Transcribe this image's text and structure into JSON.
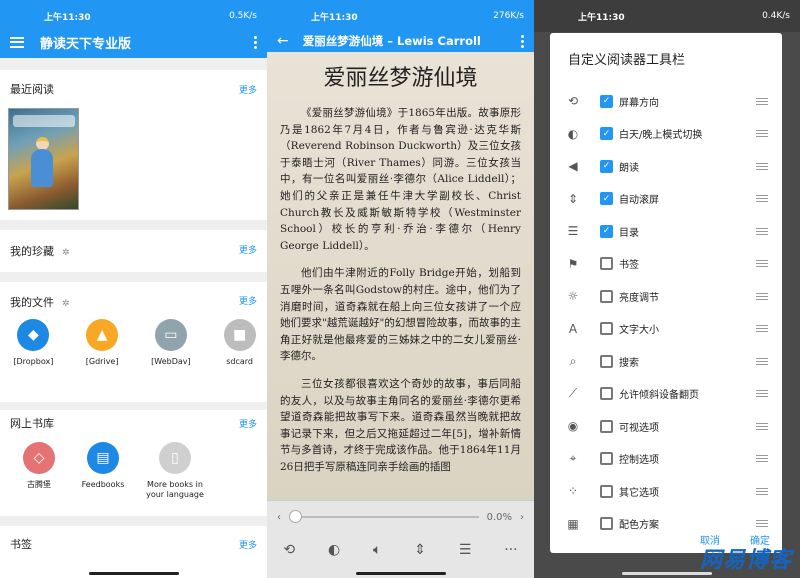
{
  "panel1": {
    "status": {
      "time": "上午11:30",
      "speed": "0.5K/s"
    },
    "appbar": {
      "title": "静读天下专业版"
    },
    "recent": {
      "label": "最近阅读",
      "more": "更多"
    },
    "fav": {
      "label": "我的珍藏",
      "more": "更多"
    },
    "files": {
      "label": "我的文件",
      "more": "更多",
      "items": [
        {
          "label": "[Dropbox]",
          "color": "#1e88e5",
          "icon": "dropbox-icon"
        },
        {
          "label": "[Gdrive]",
          "color": "#f9a825",
          "icon": "gdrive-icon"
        },
        {
          "label": "[WebDav]",
          "color": "#90a4ae",
          "icon": "webdav-icon"
        },
        {
          "label": "sdcard",
          "color": "#bdbdbd",
          "icon": "folder-icon"
        }
      ]
    },
    "online": {
      "label": "网上书库",
      "more": "更多",
      "items": [
        {
          "label": "古腾堡",
          "color": "#e57373",
          "icon": "gutenberg-icon"
        },
        {
          "label": "Feedbooks",
          "color": "#1e88e5",
          "icon": "feedbooks-icon"
        },
        {
          "label": "More books in your language",
          "color": "#cfcfcf",
          "icon": "book-icon"
        }
      ]
    },
    "bookmarks": {
      "label": "书签",
      "more": "更多"
    }
  },
  "panel2": {
    "status": {
      "time": "上午11:30",
      "speed": "276K/s"
    },
    "appbar": {
      "title": "爱丽丝梦游仙境 – Lewis Carroll"
    },
    "heading": "爱丽丝梦游仙境",
    "p1": "《爱丽丝梦游仙境》于1865年出版。故事原形乃是1862年7月4日，作者与鲁宾逊·达克华斯（Reverend Robinson Duckworth）及三位女孩于泰晤士河（River Thames）同游。三位女孩当中，有一位名叫爱丽丝·李德尔（Alice Liddell）；她们的父亲正是兼任牛津大学副校长、Christ Church教长及威斯敏斯特学校（Westminster School）校长的亨利·乔治·李德尔（Henry George Liddell）。",
    "p2": "他们由牛津附近的Folly Bridge开始，划船到五哩外一条名叫Godstow的村庄。途中，他们为了消磨时间，道奇森就在船上向三位女孩讲了一个应她们要求\"越荒诞越好\"的幻想冒险故事，而故事的主角正好就是他最疼爱的三姊妹之中的二女儿爱丽丝·李德尔。",
    "p3": "三位女孩都很喜欢这个奇妙的故事，事后同船的友人，以及与故事主角同名的爱丽丝·李德尔更希望道奇森能把故事写下来。道奇森虽然当晚就把故事记录下来，但之后又拖延超过二年[5]，增补新情节与多首诗，才终于完成该作品。他于1864年11月26日把手写原稿连同亲手绘画的插图",
    "progress": "0.0%",
    "progress_fraction": 0.0
  },
  "panel3": {
    "status": {
      "time": "上午11:30",
      "speed": "0.4K/s"
    },
    "dialog": {
      "title": "自定义阅读器工具栏",
      "items": [
        {
          "label": "屏幕方向",
          "checked": true,
          "icon": "rotate-icon"
        },
        {
          "label": "白天/晚上模式切换",
          "checked": true,
          "icon": "day-night-icon"
        },
        {
          "label": "朗读",
          "checked": true,
          "icon": "speaker-icon"
        },
        {
          "label": "自动滚屏",
          "checked": true,
          "icon": "autoscroll-icon"
        },
        {
          "label": "目录",
          "checked": true,
          "icon": "toc-icon"
        },
        {
          "label": "书签",
          "checked": false,
          "icon": "bookmark-icon"
        },
        {
          "label": "亮度调节",
          "checked": false,
          "icon": "brightness-icon"
        },
        {
          "label": "文字大小",
          "checked": false,
          "icon": "font-size-icon"
        },
        {
          "label": "搜索",
          "checked": false,
          "icon": "search-icon"
        },
        {
          "label": "允许倾斜设备翻页",
          "checked": false,
          "icon": "tilt-icon"
        },
        {
          "label": "可视选项",
          "checked": false,
          "icon": "eye-icon"
        },
        {
          "label": "控制选项",
          "checked": false,
          "icon": "control-icon"
        },
        {
          "label": "其它选项",
          "checked": false,
          "icon": "more-options-icon"
        },
        {
          "label": "配色方案",
          "checked": false,
          "icon": "color-scheme-icon"
        }
      ],
      "cancel": "取消",
      "ok": "确定"
    },
    "watermark": "网易博客"
  }
}
